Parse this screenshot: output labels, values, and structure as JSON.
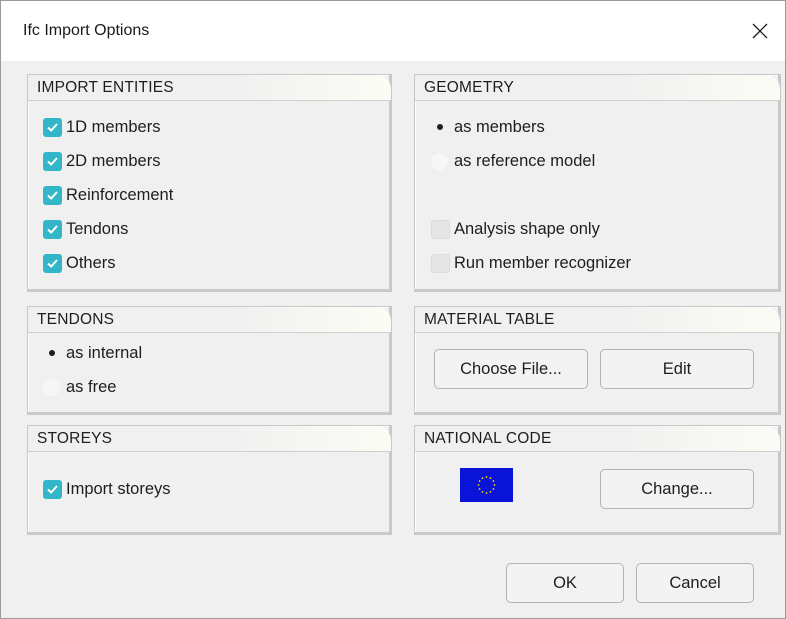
{
  "window": {
    "title": "Ifc Import Options"
  },
  "import_entities": {
    "header": "IMPORT ENTITIES",
    "items": [
      {
        "label": "1D members",
        "checked": true
      },
      {
        "label": "2D members",
        "checked": true
      },
      {
        "label": "Reinforcement",
        "checked": true
      },
      {
        "label": "Tendons",
        "checked": true
      },
      {
        "label": "Others",
        "checked": true
      }
    ]
  },
  "geometry": {
    "header": "GEOMETRY",
    "radios": [
      {
        "label": "as members",
        "selected": true
      },
      {
        "label": "as reference model",
        "selected": false
      }
    ],
    "checks": [
      {
        "label": "Analysis shape only",
        "checked": false
      },
      {
        "label": "Run member recognizer",
        "checked": false
      }
    ]
  },
  "tendons": {
    "header": "TENDONS",
    "radios": [
      {
        "label": "as internal",
        "selected": true
      },
      {
        "label": "as free",
        "selected": false
      }
    ]
  },
  "material_table": {
    "header": "MATERIAL TABLE",
    "choose_file_label": "Choose File...",
    "edit_label": "Edit"
  },
  "storeys": {
    "header": "STOREYS",
    "import_storeys": {
      "label": "Import storeys",
      "checked": true
    }
  },
  "national_code": {
    "header": "NATIONAL CODE",
    "flag_icon": "eu-flag-icon",
    "change_label": "Change..."
  },
  "footer": {
    "ok_label": "OK",
    "cancel_label": "Cancel"
  },
  "colors": {
    "check_accent": "#33b7c8",
    "flag_blue": "#0a14d8",
    "flag_stars": "#ffd700"
  }
}
